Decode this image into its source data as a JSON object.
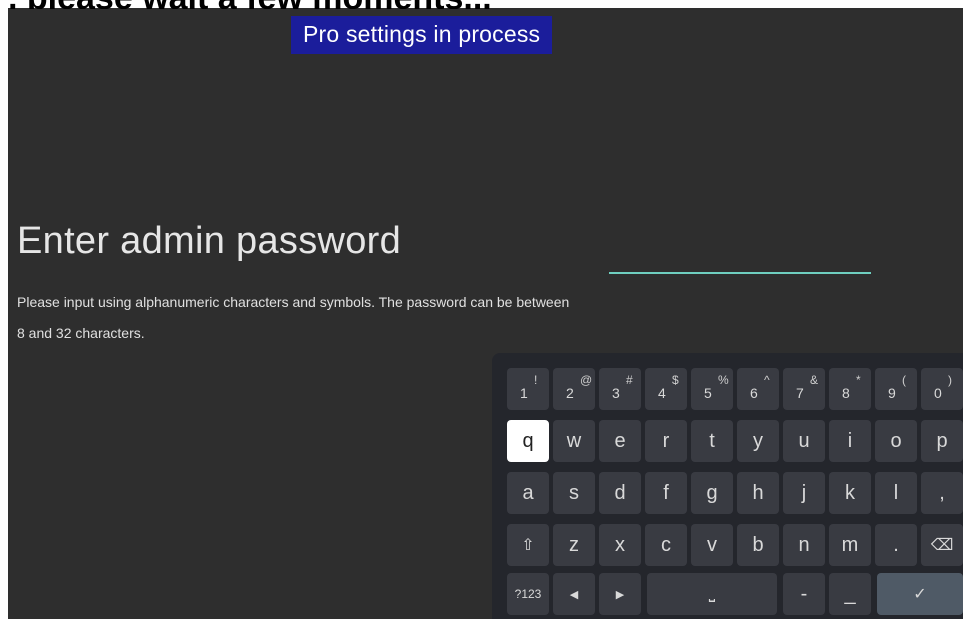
{
  "header": {
    "clipped_text": ", please wait a few moments...",
    "banner": "Pro settings in process"
  },
  "page": {
    "title": "Enter admin password",
    "description": "Please input using alphanumeric characters and symbols. The password can be between 8 and 32 characters."
  },
  "password_field": {
    "value": ""
  },
  "keyboard": {
    "row_numbers": [
      {
        "main": "1",
        "sup": "!"
      },
      {
        "main": "2",
        "sup": "@"
      },
      {
        "main": "3",
        "sup": "#"
      },
      {
        "main": "4",
        "sup": "$"
      },
      {
        "main": "5",
        "sup": "%"
      },
      {
        "main": "6",
        "sup": "^"
      },
      {
        "main": "7",
        "sup": "&"
      },
      {
        "main": "8",
        "sup": "*"
      },
      {
        "main": "9",
        "sup": "("
      },
      {
        "main": "0",
        "sup": ")"
      }
    ],
    "row1": [
      "q",
      "w",
      "e",
      "r",
      "t",
      "y",
      "u",
      "i",
      "o",
      "p"
    ],
    "row2": [
      "a",
      "s",
      "d",
      "f",
      "g",
      "h",
      "j",
      "k",
      "l",
      ","
    ],
    "row3": {
      "shift": "⇧",
      "letters": [
        "z",
        "x",
        "c",
        "v",
        "b",
        "n",
        "m",
        "."
      ],
      "backspace": "⌫"
    },
    "row4": {
      "symbols": "?123",
      "left": "◀",
      "right": "▶",
      "space": "⎵",
      "dash": "-",
      "underscore": "_",
      "enter": "✓"
    },
    "selected_key": "q"
  }
}
